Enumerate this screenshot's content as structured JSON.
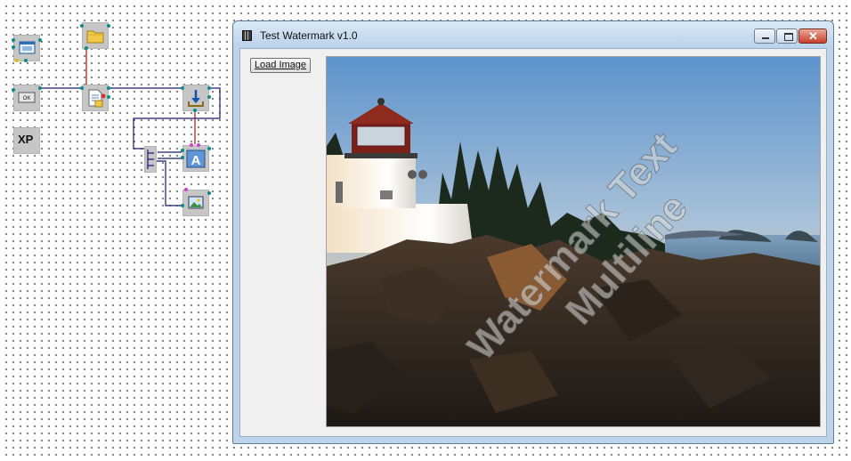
{
  "window": {
    "title": "Test Watermark v1.0",
    "buttons": {
      "minimize": "minimize",
      "maximize": "maximize",
      "close": "close"
    }
  },
  "form": {
    "load_button": "Load Image"
  },
  "image": {
    "watermark_line1": "Watermark Text",
    "watermark_line2": "Multiline"
  },
  "schematic": {
    "components": [
      "form",
      "open-dialog",
      "button",
      "file-reader",
      "xp-style",
      "download",
      "hub",
      "text",
      "image"
    ],
    "labels": {
      "button_caption": "OK",
      "xp": "XP"
    }
  },
  "colors": {
    "wire_red": "#a01818",
    "wire_navy": "#1a1a6e",
    "pin": "#0b8a8a",
    "close_button": "#c8412b"
  }
}
